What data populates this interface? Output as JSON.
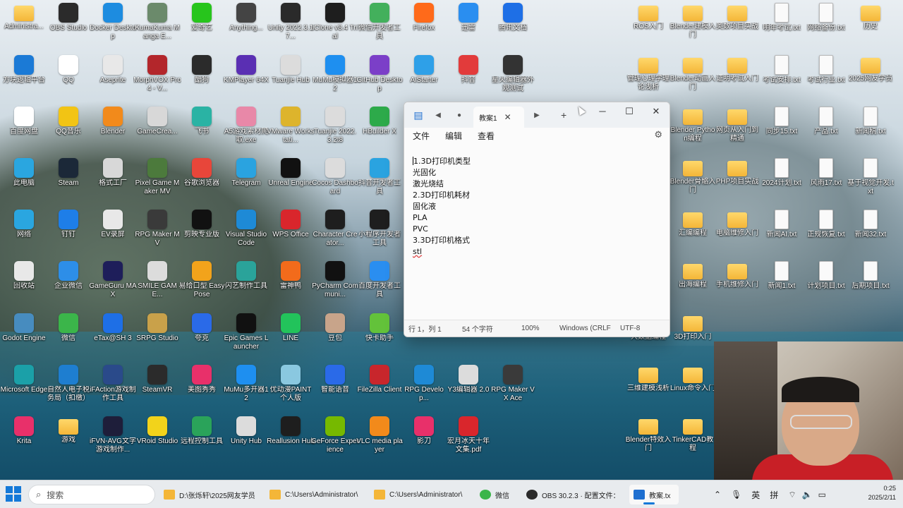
{
  "desktop": {
    "icons": [
      {
        "label": "Administra...",
        "icon": "folder-icon",
        "color": "#f4b638"
      },
      {
        "label": "OBS Studio",
        "icon": "obs-icon",
        "color": "#2b2b2b"
      },
      {
        "label": "Docker Desktop",
        "icon": "docker-icon",
        "color": "#1d8ce0"
      },
      {
        "label": "KumaKuma Manga E...",
        "icon": "kumakuma-icon",
        "color": "#6b8a6b"
      },
      {
        "label": "爱奇艺",
        "icon": "iqiyi-icon",
        "color": "#27c51c"
      },
      {
        "label": "Anything...",
        "icon": "anything-icon",
        "color": "#444444"
      },
      {
        "label": "Unity 2022.3.17...",
        "icon": "unity-icon",
        "color": "#2a2a2a"
      },
      {
        "label": "iClone v8.4 Trial",
        "icon": "iclone-icon",
        "color": "#1e1e1e"
      },
      {
        "label": "微信开发者工具",
        "icon": "wechat-devtools-icon",
        "color": "#43b05c"
      },
      {
        "label": "Firefox",
        "icon": "firefox-icon",
        "color": "#ff6a1a"
      },
      {
        "label": "迅雷",
        "icon": "xunlei-icon",
        "color": "#2a8ef0"
      },
      {
        "label": "腾讯文档",
        "icon": "tencent-docs-icon",
        "color": "#1e6fe6"
      },
      {
        "label": "方块逻辑平台",
        "icon": "block-icon",
        "color": "#1b7ad6"
      },
      {
        "label": "QQ",
        "icon": "qq-icon",
        "color": "#ffffff"
      },
      {
        "label": "Aseprite",
        "icon": "aseprite-icon",
        "color": "#e8e8e8"
      },
      {
        "label": "MorphVOX Pro 4 - V...",
        "icon": "morphvox-icon",
        "color": "#b3262b"
      },
      {
        "label": "酷狗",
        "icon": "kugou-icon",
        "color": "#2b2b2b"
      },
      {
        "label": "KMPlayer 64X",
        "icon": "kmplayer-icon",
        "color": "#5a2fb3"
      },
      {
        "label": "Tuanjie Hub",
        "icon": "tuanjie-hub-icon",
        "color": "#dcdcdc"
      },
      {
        "label": "MuMu模拟器12",
        "icon": "mumu-icon",
        "color": "#1e8ff0"
      },
      {
        "label": "GitHub Desktop",
        "icon": "github-desktop-icon",
        "color": "#7b3fc8"
      },
      {
        "label": "AiStarter",
        "icon": "aistarter-icon",
        "color": "#2ea0e8"
      },
      {
        "label": "抖音",
        "icon": "douyin-icon",
        "color": "#e23b3b"
      },
      {
        "label": "星火编辑器外观测试",
        "icon": "spark-icon",
        "color": "#333333"
      },
      {
        "label": "百度网盘",
        "icon": "baidu-netdisk-icon",
        "color": "#ffffff"
      },
      {
        "label": "QQ音乐",
        "icon": "qqmusic-icon",
        "color": "#f2c414"
      },
      {
        "label": "Blender",
        "icon": "blender-icon",
        "color": "#f28a1b"
      },
      {
        "label": "GameCrea...",
        "icon": "gamecreator-icon",
        "color": "#d8d8d8"
      },
      {
        "label": "飞书",
        "icon": "feishu-icon",
        "color": "#2ab3a4"
      },
      {
        "label": "A5游戏素材爬取.exe",
        "icon": "anime-icon",
        "color": "#e888a8"
      },
      {
        "label": "VMware Workstati...",
        "icon": "vmware-icon",
        "color": "#ddb42c"
      },
      {
        "label": "Tuanjie 2022.3.2t8",
        "icon": "tuanjie-icon",
        "color": "#dcdcdc"
      },
      {
        "label": "HBuilder X",
        "icon": "hbuilder-icon",
        "color": "#2daa4a"
      },
      {
        "label": "此电脑",
        "icon": "this-pc-icon",
        "color": "#2aa6e0"
      },
      {
        "label": "Steam",
        "icon": "steam-icon",
        "color": "#1b2838"
      },
      {
        "label": "格式工厂",
        "icon": "format-factory-icon",
        "color": "#d8d8d8"
      },
      {
        "label": "Pixel Game Maker MV",
        "icon": "pixel-game-icon",
        "color": "#4c7a3c"
      },
      {
        "label": "谷歌浏览器",
        "icon": "chrome-icon",
        "color": "#e8463a"
      },
      {
        "label": "Telegram",
        "icon": "telegram-icon",
        "color": "#2aa3e0"
      },
      {
        "label": "Unreal Engine",
        "icon": "unreal-icon",
        "color": "#111111"
      },
      {
        "label": "Cocos Dashboard",
        "icon": "cocos-icon",
        "color": "#dcdcdc"
      },
      {
        "label": "抖音开发者工具",
        "icon": "douyin-dev-icon",
        "color": "#2aa3e0"
      },
      {
        "label": "网络",
        "icon": "network-icon",
        "color": "#2aa6e0"
      },
      {
        "label": "钉钉",
        "icon": "dingtalk-icon",
        "color": "#1e7ee8"
      },
      {
        "label": "EV录屏",
        "icon": "ev-recorder-icon",
        "color": "#e8e8e8"
      },
      {
        "label": "RPG Maker MV",
        "icon": "rpgmaker-icon",
        "color": "#3a3a3a"
      },
      {
        "label": "剪映专业版",
        "icon": "jianying-icon",
        "color": "#111111"
      },
      {
        "label": "Visual Studio Code",
        "icon": "vscode-icon",
        "color": "#1e8ad6"
      },
      {
        "label": "WPS Office",
        "icon": "wps-icon",
        "color": "#d9262c"
      },
      {
        "label": "Character Creator...",
        "icon": "character-creator-icon",
        "color": "#1e1e1e"
      },
      {
        "label": "小程序开发者工具",
        "icon": "miniprogram-icon",
        "color": "#1e1e1e"
      },
      {
        "label": "回收站",
        "icon": "recycle-bin-icon",
        "color": "#e8e8e8"
      },
      {
        "label": "企业微信",
        "icon": "wecom-icon",
        "color": "#2d8ee8"
      },
      {
        "label": "GameGuru MAX",
        "icon": "gameguru-icon",
        "color": "#1e1e5a"
      },
      {
        "label": "SMILE GAME...",
        "icon": "smile-game-icon",
        "color": "#dcdcdc"
      },
      {
        "label": "易给口型 Easy Pose",
        "icon": "easy-pose-icon",
        "color": "#f2a31b"
      },
      {
        "label": "闪艺制作工具",
        "icon": "shanyi-icon",
        "color": "#2aa39a"
      },
      {
        "label": "雷神鸭",
        "icon": "leishen-icon",
        "color": "#f26b1b"
      },
      {
        "label": "PyCharm Communi...",
        "icon": "pycharm-icon",
        "color": "#111111"
      },
      {
        "label": "百度开发者工具",
        "icon": "baidu-dev-icon",
        "color": "#2a8ef0"
      },
      {
        "label": "Godot Engine",
        "icon": "godot-icon",
        "color": "#478cbf"
      },
      {
        "label": "微信",
        "icon": "wechat-icon",
        "color": "#3bb54a"
      },
      {
        "label": "eTax@SH 3",
        "icon": "etax-icon",
        "color": "#1e6fe6"
      },
      {
        "label": "SRPG Studio",
        "icon": "srpg-icon",
        "color": "#c9a14a"
      },
      {
        "label": "夸克",
        "icon": "quark-icon",
        "color": "#2a6ae8"
      },
      {
        "label": "Epic Games Launcher",
        "icon": "epic-games-icon",
        "color": "#111111"
      },
      {
        "label": "LINE",
        "icon": "line-icon",
        "color": "#22c35b"
      },
      {
        "label": "豆包",
        "icon": "doubao-icon",
        "color": "#c8a48a"
      },
      {
        "label": "快卡助手",
        "icon": "kuaika-icon",
        "color": "#63c23a"
      },
      {
        "label": "Microsoft Edge",
        "icon": "edge-icon",
        "color": "#1ba0a8"
      },
      {
        "label": "自然人电子税务局（扣缴）",
        "icon": "tax-icon",
        "color": "#1e7ed0"
      },
      {
        "label": "iFAction游戏制作工具",
        "icon": "ifaction-icon",
        "color": "#2a4a8a"
      },
      {
        "label": "SteamVR",
        "icon": "steamvr-icon",
        "color": "#2b2b2b"
      },
      {
        "label": "美图秀秀",
        "icon": "meitu-icon",
        "color": "#e8306a"
      },
      {
        "label": "MuMu多开器12",
        "icon": "mumu-multi-icon",
        "color": "#1e8ff0"
      },
      {
        "label": "优动漫PAINT个人版",
        "icon": "clip-paint-icon",
        "color": "#8ac8e0"
      },
      {
        "label": "智能语音",
        "icon": "voice-icon",
        "color": "#2a6ae8"
      },
      {
        "label": "FileZilla Client",
        "icon": "filezilla-icon",
        "color": "#c8262c"
      },
      {
        "label": "RPG Develop...",
        "icon": "rpg-developer-icon",
        "color": "#1e8ad6"
      },
      {
        "label": "Y3编辑器 2.0",
        "icon": "y3-editor-icon",
        "color": "#dcdcdc"
      },
      {
        "label": "RPG Maker VX Ace",
        "icon": "rpgmaker-vx-icon",
        "color": "#3a3a3a"
      },
      {
        "label": "Krita",
        "icon": "krita-icon",
        "color": "#e8306a"
      },
      {
        "label": "游戏",
        "icon": "folder-icon",
        "color": "#f4b638"
      },
      {
        "label": "iFVN-AVG文字游戏制作...",
        "icon": "ifvn-icon",
        "color": "#1e1e3a"
      },
      {
        "label": "VRoid Studio",
        "icon": "vroid-icon",
        "color": "#f2d31b"
      },
      {
        "label": "远程控制工具",
        "icon": "remote-icon",
        "color": "#2aa35a"
      },
      {
        "label": "Unity Hub",
        "icon": "unity-hub-icon",
        "color": "#dcdcdc"
      },
      {
        "label": "Reallusion Hub",
        "icon": "reallusion-icon",
        "color": "#1e1e1e"
      },
      {
        "label": "GeForce Experience",
        "icon": "geforce-icon",
        "color": "#76b900"
      },
      {
        "label": "VLC media player",
        "icon": "vlc-icon",
        "color": "#f28a1b"
      },
      {
        "label": "影刀",
        "icon": "yingdao-icon",
        "color": "#e8306a"
      },
      {
        "label": "宏月冰天十年文集.pdf",
        "icon": "pdf-icon",
        "color": "#d9262c"
      },
      {
        "label": "ROS入门",
        "icon": "folder-icon",
        "color": "#f4b638"
      },
      {
        "label": "Blender建模入门",
        "icon": "folder-icon",
        "color": "#f4b638"
      },
      {
        "label": "奥数项目实战",
        "icon": "folder-icon",
        "color": "#f4b638"
      },
      {
        "label": "明年考试.txt",
        "icon": "text-file-icon",
        "color": "#fafafa"
      },
      {
        "label": "网络备份.txt",
        "icon": "text-file-icon",
        "color": "#fafafa"
      },
      {
        "label": "历史",
        "icon": "folder-icon",
        "color": "#f4b638"
      },
      {
        "label": "管理心理学理论浅析",
        "icon": "folder-icon",
        "color": "#f4b638"
      },
      {
        "label": "Blender动画入门",
        "icon": "folder-icon",
        "color": "#f4b638"
      },
      {
        "label": "证明考试入门",
        "icon": "folder-icon",
        "color": "#f4b638"
      },
      {
        "label": "考试安排.txt",
        "icon": "text-file-icon",
        "color": "#fafafa"
      },
      {
        "label": "考试行业.txt",
        "icon": "text-file-icon",
        "color": "#fafafa"
      },
      {
        "label": "2025网友学员",
        "icon": "folder-icon",
        "color": "#f4b638"
      },
      {
        "label": "Blender Python编程",
        "icon": "folder-icon",
        "color": "#f4b638"
      },
      {
        "label": "网页从入门到精通",
        "icon": "folder-icon",
        "color": "#f4b638"
      },
      {
        "label": "同步15.txt",
        "icon": "text-file-icon",
        "color": "#fafafa"
      },
      {
        "label": "产品.txt",
        "icon": "text-file-icon",
        "color": "#fafafa"
      },
      {
        "label": "新闻稿.txt",
        "icon": "text-file-icon",
        "color": "#fafafa"
      },
      {
        "label": "Blender骨骼入门",
        "icon": "folder-icon",
        "color": "#f4b638"
      },
      {
        "label": "PHP项目实战",
        "icon": "folder-icon",
        "color": "#f4b638"
      },
      {
        "label": "2024计划.txt",
        "icon": "text-file-icon",
        "color": "#fafafa"
      },
      {
        "label": "风雨17.txt",
        "icon": "text-file-icon",
        "color": "#fafafa"
      },
      {
        "label": "基于视觉开发.txt",
        "icon": "text-file-icon",
        "color": "#fafafa"
      },
      {
        "label": "汇编编程",
        "icon": "folder-icon",
        "color": "#f4b638"
      },
      {
        "label": "电脑维修入门",
        "icon": "folder-icon",
        "color": "#f4b638"
      },
      {
        "label": "新闻AI.txt",
        "icon": "text-file-icon",
        "color": "#fafafa"
      },
      {
        "label": "正规恢复.txt",
        "icon": "text-file-icon",
        "color": "#fafafa"
      },
      {
        "label": "新闻32.txt",
        "icon": "text-file-icon",
        "color": "#fafafa"
      },
      {
        "label": "出海编程",
        "icon": "folder-icon",
        "color": "#f4b638"
      },
      {
        "label": "手机维修入门",
        "icon": "folder-icon",
        "color": "#f4b638"
      },
      {
        "label": "新闻1.txt",
        "icon": "text-file-icon",
        "color": "#fafafa"
      },
      {
        "label": "计划项目.txt",
        "icon": "text-file-icon",
        "color": "#fafafa"
      },
      {
        "label": "后期项目.txt",
        "icon": "text-file-icon",
        "color": "#fafafa"
      },
      {
        "label": "大数据编程",
        "icon": "folder-icon",
        "color": "#f4b638"
      },
      {
        "label": "3D打印入门",
        "icon": "folder-icon",
        "color": "#f4b638"
      },
      {
        "label": "三维建模浅析",
        "icon": "folder-icon",
        "color": "#f4b638"
      },
      {
        "label": "Linux命令入门",
        "icon": "folder-icon",
        "color": "#f4b638"
      },
      {
        "label": "Blender特效入门",
        "icon": "folder-icon",
        "color": "#f4b638"
      },
      {
        "label": "TinkerCAD教程",
        "icon": "folder-icon",
        "color": "#f4b638"
      }
    ]
  },
  "notepad": {
    "tab_title": "教案1",
    "menu": [
      "文件",
      "编辑",
      "查看"
    ],
    "lines": [
      "1.3D打印机类型",
      "光固化",
      "激光烧结",
      "2.3D打印机耗材",
      "固化液",
      "PLA",
      "PVC",
      "3.3D打印机格式",
      "stl"
    ],
    "status": {
      "position": "行 1，列 1",
      "chars": "54 个字符",
      "zoom": "100%",
      "line_ending": "Windows (CRLF",
      "encoding": "UTF-8"
    }
  },
  "taskbar": {
    "search_placeholder": "搜索",
    "items": [
      {
        "label": "D:\\张烁轩\\2025网友学员",
        "icon": "folder-icon"
      },
      {
        "label": "C:\\Users\\Administrator\\",
        "icon": "folder-icon"
      },
      {
        "label": "C:\\Users\\Administrator\\",
        "icon": "folder-icon"
      },
      {
        "label": "微信",
        "icon": "wechat-icon"
      },
      {
        "label": "OBS 30.2.3 · 配置文件：",
        "icon": "obs-icon"
      },
      {
        "label": "教案.tx",
        "icon": "notepad-icon"
      }
    ],
    "ime_lang": "英",
    "ime_mode": "拼",
    "time": "0:25",
    "date": "2025/2/11"
  }
}
